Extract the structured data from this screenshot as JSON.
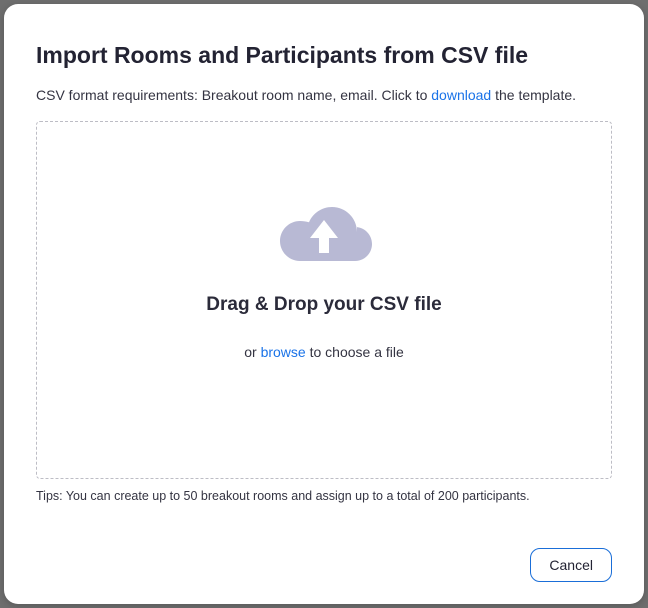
{
  "title": "Import Rooms and Participants from CSV file",
  "subtitle": {
    "prefix": "CSV format requirements: Breakout room name, email. Click to ",
    "link": "download",
    "suffix": " the template."
  },
  "dropzone": {
    "heading": "Drag & Drop your CSV file",
    "or": "or ",
    "browse": "browse",
    "or_suffix": " to choose a file"
  },
  "tips": "Tips: You can create up to 50 breakout rooms and assign up to a total of 200 participants.",
  "buttons": {
    "cancel": "Cancel"
  },
  "colors": {
    "link": "#1a73e8",
    "icon": "#b8b9d4"
  }
}
